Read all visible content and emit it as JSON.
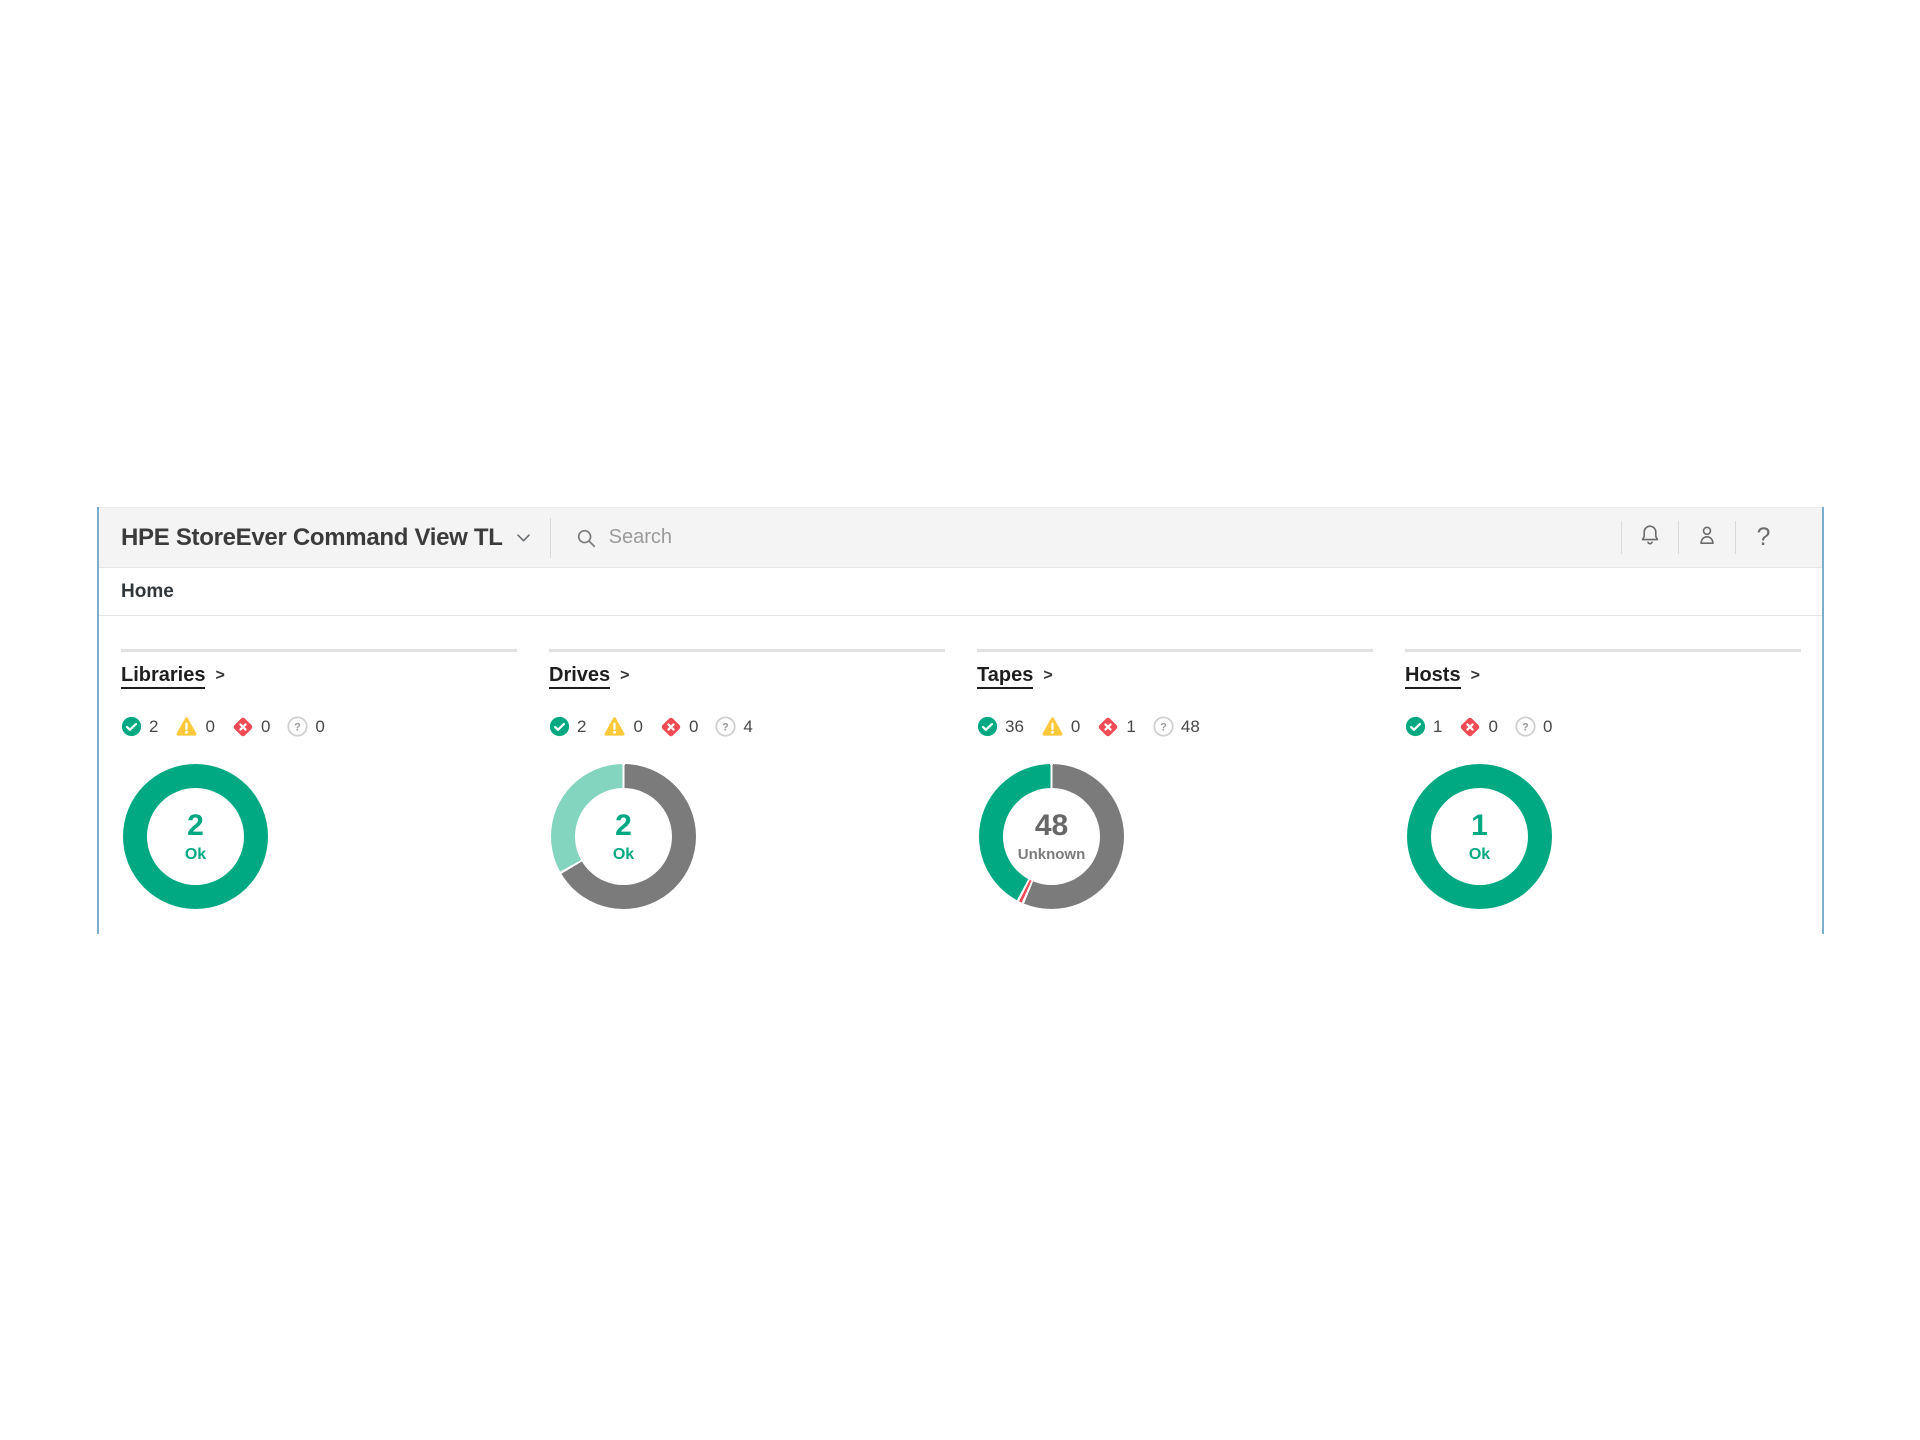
{
  "header": {
    "app_title": "HPE StoreEver Command View TL",
    "search_placeholder": "Search",
    "help_glyph": "?",
    "icons": [
      "chevron-down-icon",
      "search-icon",
      "bell-icon",
      "person-icon",
      "help-icon"
    ]
  },
  "breadcrumb": "Home",
  "panel_arrow": ">",
  "colors": {
    "hpe_green": "#01a982",
    "ok_light_teal": "#84d5c0",
    "warning_yellow": "#fdc83a",
    "critical_red": "#f04a54",
    "unknown_gray": "#7b7b7b",
    "header_bg": "#f4f4f4",
    "side_border_blue": "#7aaecf",
    "center_gray_text": "#676767"
  },
  "status_icons": [
    "ok-icon",
    "warning-icon",
    "critical-icon",
    "unknown-icon"
  ],
  "panels": [
    {
      "title": "Libraries",
      "status": {
        "ok": 2,
        "warning": 0,
        "critical": 0,
        "unknown": 0
      },
      "center": {
        "value": "2",
        "label": "Ok"
      },
      "donut": {
        "segments": [
          {
            "name": "ok",
            "value": 2,
            "color": "#01a982"
          }
        ]
      }
    },
    {
      "title": "Drives",
      "status": {
        "ok": 2,
        "warning": 0,
        "critical": 0,
        "unknown": 4
      },
      "center": {
        "value": "2",
        "label": "Ok"
      },
      "donut": {
        "segments": [
          {
            "name": "unknown",
            "value": 4,
            "color": "#7b7b7b"
          },
          {
            "name": "ok",
            "value": 2,
            "color": "#84d5c0"
          }
        ]
      }
    },
    {
      "title": "Tapes",
      "status": {
        "ok": 36,
        "warning": 0,
        "critical": 1,
        "unknown": 48
      },
      "center": {
        "value": "48",
        "label": "Unknown"
      },
      "donut": {
        "segments": [
          {
            "name": "unknown",
            "value": 48,
            "color": "#7b7b7b"
          },
          {
            "name": "critical",
            "value": 1,
            "color": "#f04a54"
          },
          {
            "name": "ok",
            "value": 36,
            "color": "#01a982"
          }
        ]
      }
    },
    {
      "title": "Hosts",
      "status": {
        "ok": 1,
        "critical": 0,
        "unknown": 0
      },
      "center": {
        "value": "1",
        "label": "Ok"
      },
      "donut": {
        "segments": [
          {
            "name": "ok",
            "value": 1,
            "color": "#01a982"
          }
        ]
      }
    }
  ]
}
